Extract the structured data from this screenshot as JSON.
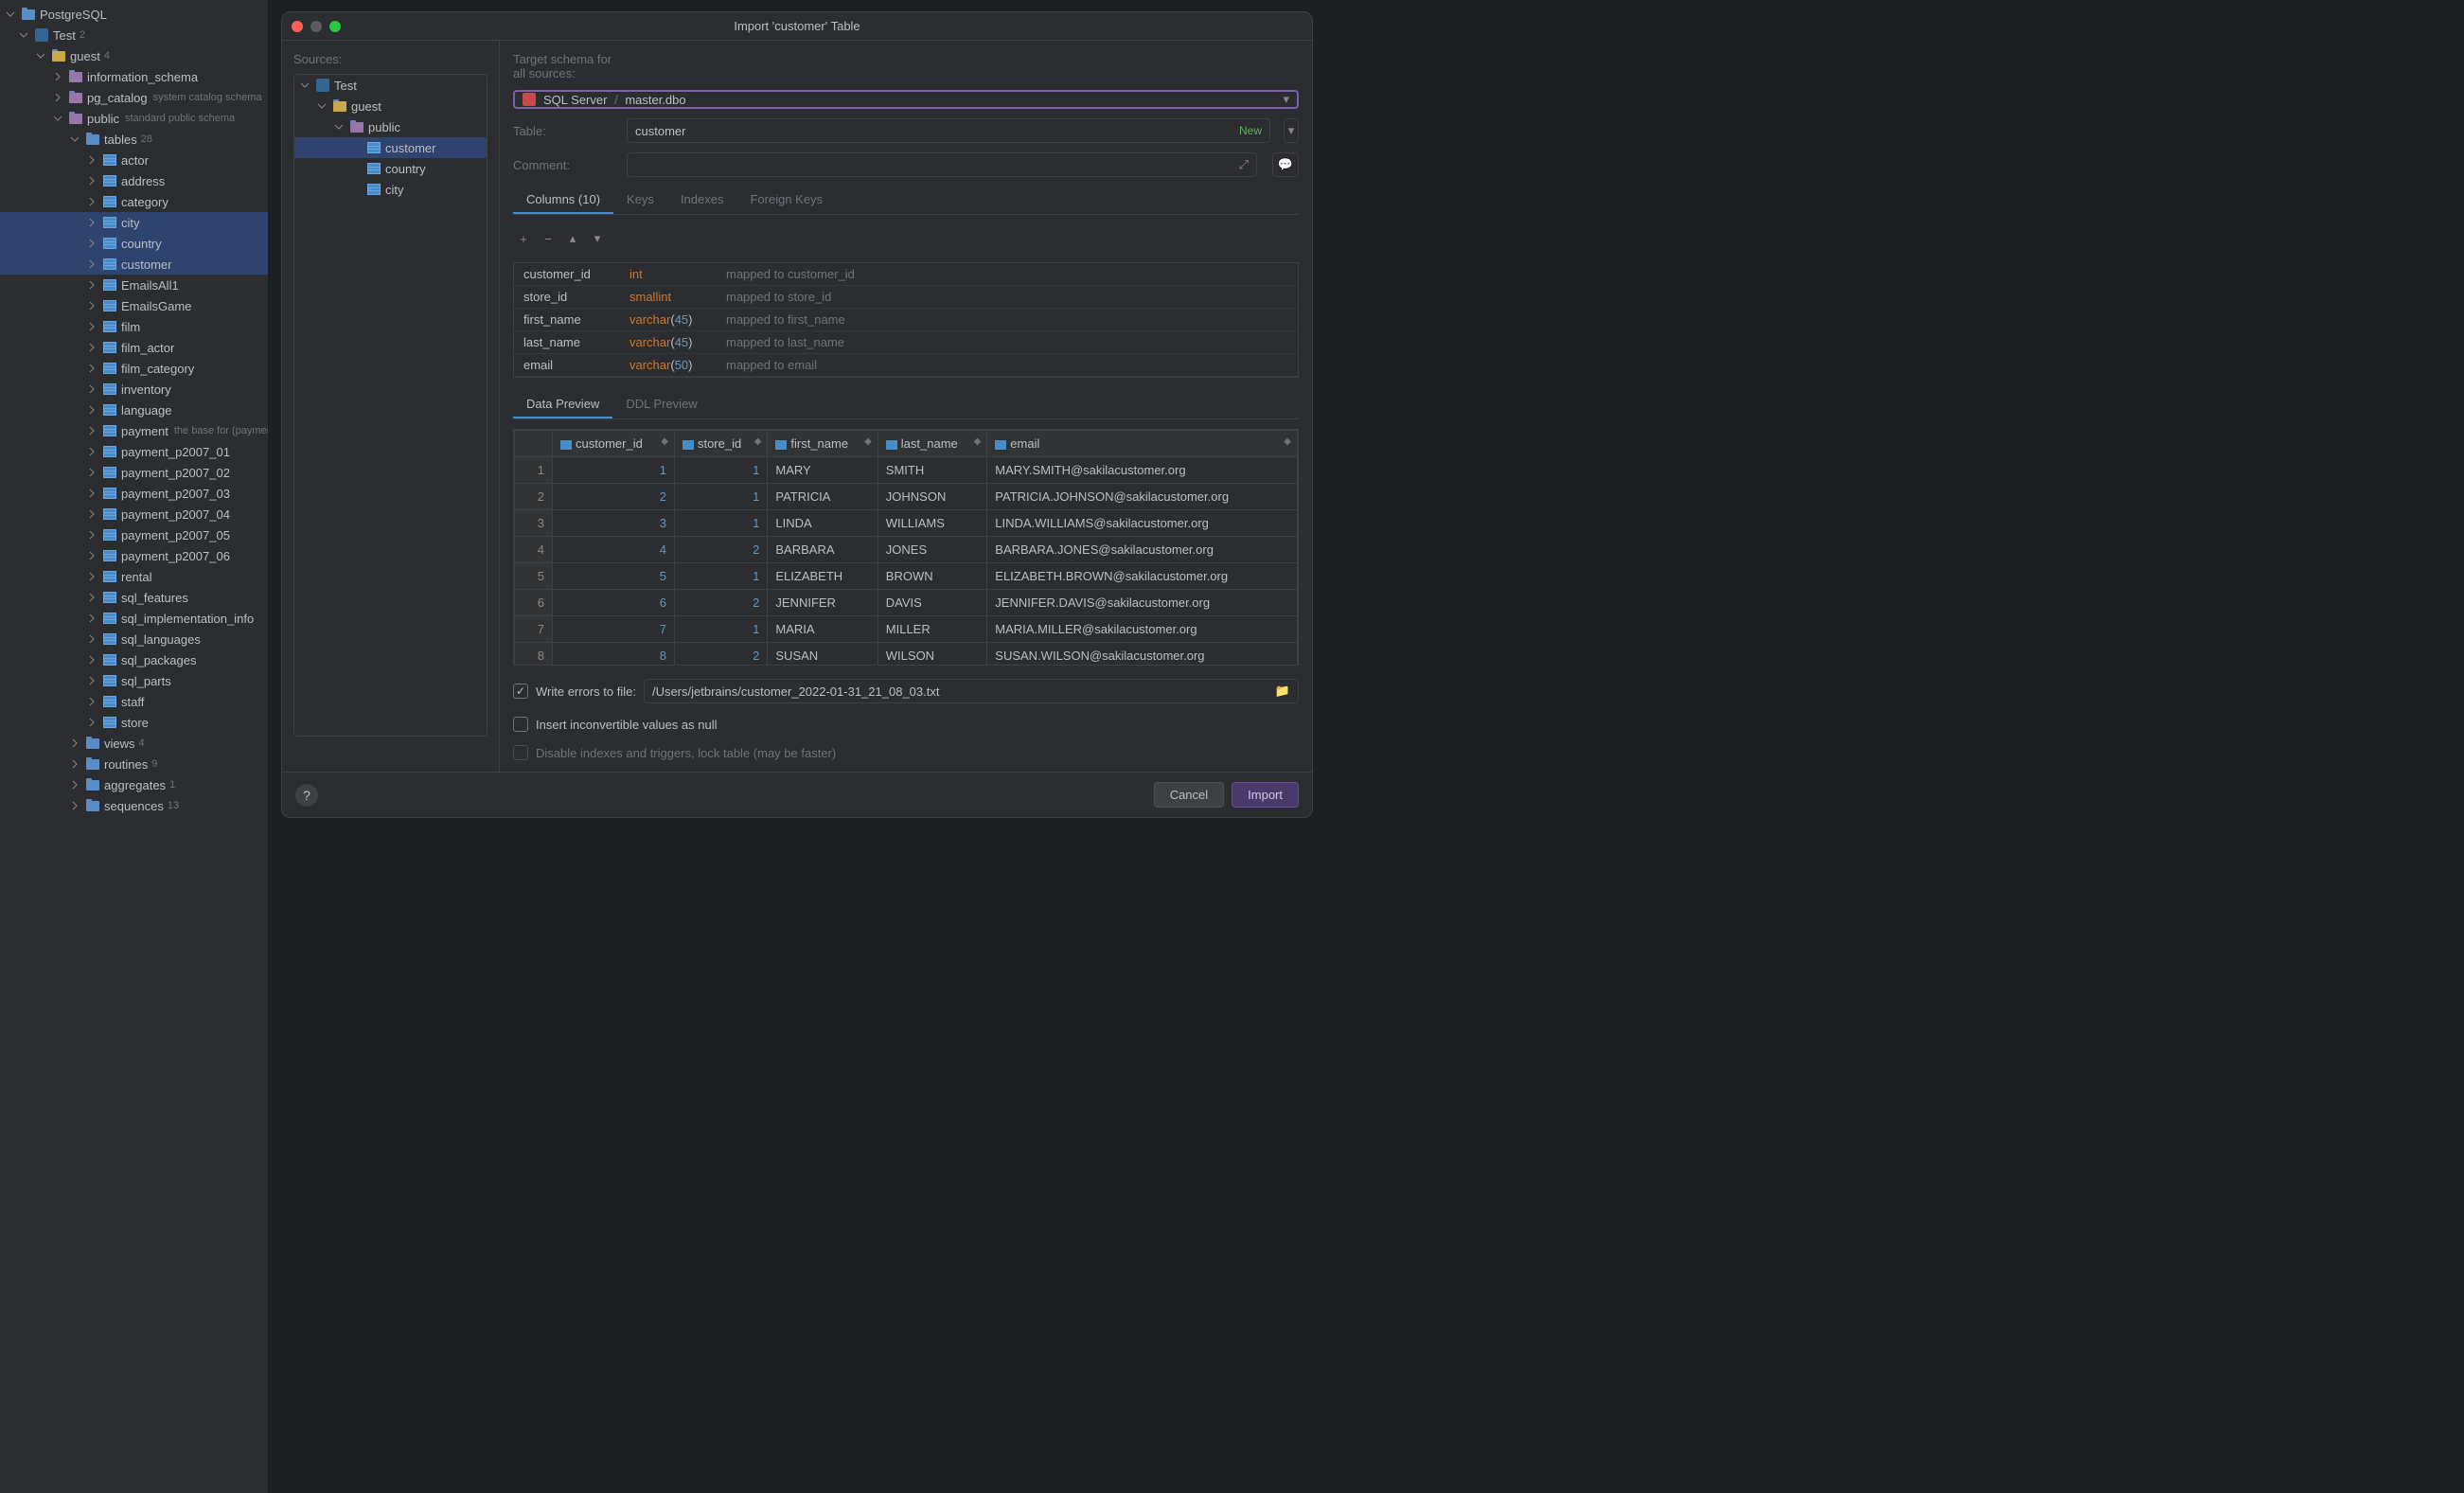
{
  "sidebar": {
    "root": "PostgreSQL",
    "test": "Test",
    "test_count": "2",
    "guest": "guest",
    "guest_count": "4",
    "schemas": [
      {
        "name": "information_schema",
        "hint": ""
      },
      {
        "name": "pg_catalog",
        "hint": "system catalog schema"
      },
      {
        "name": "public",
        "hint": "standard public schema",
        "expanded": true
      }
    ],
    "tables_label": "tables",
    "tables_count": "28",
    "tables": [
      "actor",
      "address",
      "category",
      "city",
      "country",
      "customer",
      "EmailsAll1",
      "EmailsGame",
      "film",
      "film_actor",
      "film_category",
      "inventory",
      "language",
      "payment",
      "payment_p2007_01",
      "payment_p2007_02",
      "payment_p2007_03",
      "payment_p2007_04",
      "payment_p2007_05",
      "payment_p2007_06",
      "rental",
      "sql_features",
      "sql_implementation_info",
      "sql_languages",
      "sql_packages",
      "sql_parts",
      "staff",
      "store"
    ],
    "payment_hint": "the base for (payment_*)",
    "folders": [
      {
        "name": "views",
        "count": "4"
      },
      {
        "name": "routines",
        "count": "9"
      },
      {
        "name": "aggregates",
        "count": "1"
      },
      {
        "name": "sequences",
        "count": "13"
      }
    ]
  },
  "dialog": {
    "title": "Import 'customer' Table",
    "sources_label": "Sources:",
    "sources_tree": {
      "root": "Test",
      "guest": "guest",
      "public": "public",
      "tables": [
        "customer",
        "country",
        "city"
      ]
    },
    "target_label": "Target schema for all sources:",
    "target_server": "SQL Server",
    "target_schema": "master.dbo",
    "table_label": "Table:",
    "table_value": "customer",
    "new_badge": "New",
    "comment_label": "Comment:",
    "tabs": {
      "columns": "Columns (10)",
      "keys": "Keys",
      "indexes": "Indexes",
      "foreign_keys": "Foreign Keys"
    },
    "columns": [
      {
        "name": "customer_id",
        "type": "int",
        "size": "",
        "map": "mapped to customer_id"
      },
      {
        "name": "store_id",
        "type": "smallint",
        "size": "",
        "map": "mapped to store_id"
      },
      {
        "name": "first_name",
        "type": "varchar",
        "size": "45",
        "map": "mapped to first_name"
      },
      {
        "name": "last_name",
        "type": "varchar",
        "size": "45",
        "map": "mapped to last_name"
      },
      {
        "name": "email",
        "type": "varchar",
        "size": "50",
        "map": "mapped to email"
      }
    ],
    "preview_tabs": {
      "data": "Data Preview",
      "ddl": "DDL Preview"
    },
    "headers": [
      "customer_id",
      "store_id",
      "first_name",
      "last_name",
      "email"
    ],
    "rows": [
      [
        "1",
        "1",
        "1",
        "MARY",
        "SMITH",
        "MARY.SMITH@sakilacustomer.org"
      ],
      [
        "2",
        "2",
        "1",
        "PATRICIA",
        "JOHNSON",
        "PATRICIA.JOHNSON@sakilacustomer.org"
      ],
      [
        "3",
        "3",
        "1",
        "LINDA",
        "WILLIAMS",
        "LINDA.WILLIAMS@sakilacustomer.org"
      ],
      [
        "4",
        "4",
        "2",
        "BARBARA",
        "JONES",
        "BARBARA.JONES@sakilacustomer.org"
      ],
      [
        "5",
        "5",
        "1",
        "ELIZABETH",
        "BROWN",
        "ELIZABETH.BROWN@sakilacustomer.org"
      ],
      [
        "6",
        "6",
        "2",
        "JENNIFER",
        "DAVIS",
        "JENNIFER.DAVIS@sakilacustomer.org"
      ],
      [
        "7",
        "7",
        "1",
        "MARIA",
        "MILLER",
        "MARIA.MILLER@sakilacustomer.org"
      ],
      [
        "8",
        "8",
        "2",
        "SUSAN",
        "WILSON",
        "SUSAN.WILSON@sakilacustomer.org"
      ]
    ],
    "write_errors_label": "Write errors to file:",
    "write_errors_path": "/Users/jetbrains/customer_2022-01-31_21_08_03.txt",
    "insert_null_label": "Insert inconvertible values as null",
    "disable_indexes_label": "Disable indexes and triggers, lock table (may be faster)",
    "cancel": "Cancel",
    "import": "Import"
  }
}
